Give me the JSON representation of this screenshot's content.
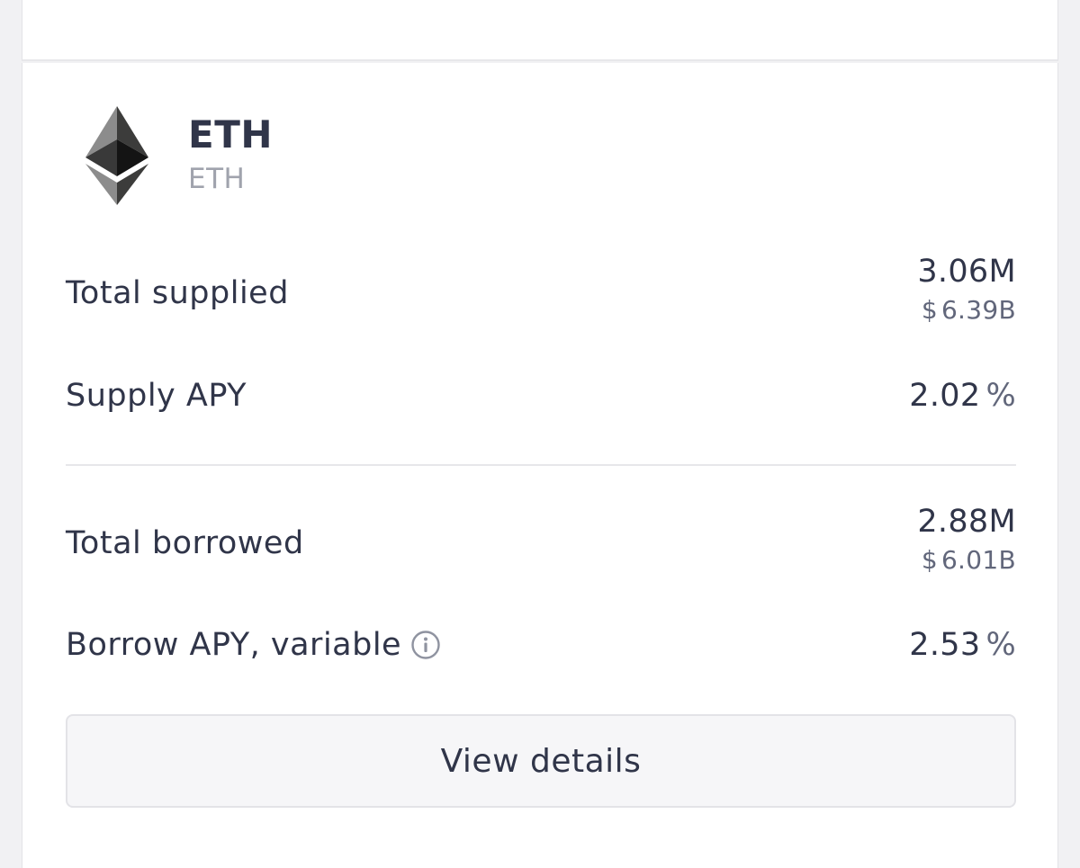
{
  "asset": {
    "name": "ETH",
    "symbol": "ETH",
    "icon": "ethereum-icon"
  },
  "supply": {
    "total_label": "Total supplied",
    "total_amount": "3.06M",
    "total_usd_symbol": "$",
    "total_usd": "6.39B",
    "apy_label": "Supply APY",
    "apy_value": "2.02",
    "apy_unit": "%"
  },
  "borrow": {
    "total_label": "Total borrowed",
    "total_amount": "2.88M",
    "total_usd_symbol": "$",
    "total_usd": "6.01B",
    "apy_label": "Borrow APY, variable",
    "apy_value": "2.53",
    "apy_unit": "%",
    "info_icon": "info-icon"
  },
  "actions": {
    "view_details_label": "View details"
  },
  "colors": {
    "text_primary": "#303549",
    "text_secondary": "#62677b",
    "text_muted": "#a0a3ad",
    "card_background": "#ffffff",
    "page_background": "#f1f1f3",
    "button_background": "#f6f6f8",
    "border": "#e3e3e7"
  }
}
